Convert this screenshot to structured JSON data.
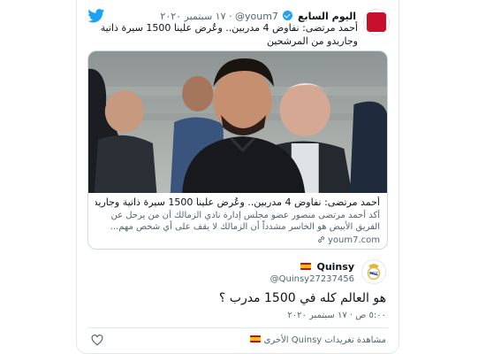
{
  "quoted_tweet": {
    "author_name": "اليوم السابع",
    "avatar_text": "اليوم\nالسابع",
    "handle": "@youm7",
    "date": "١٧ سبتمبر ٢٠٢٠",
    "separator": "·",
    "text": "أحمد مرتضى: نفاوض 4 مدربين.. وعُرض علينا 1500 سيرة ذاتية وجاريدو من المرشحين",
    "link_card": {
      "title": "أحمد مرتضى: نفاوض 4 مدربين.. وعُرض علينا 1500 سيرة ذاتية وجاريدو ...",
      "description": "أكد أحمد مرتضى منصور عضو مجلس إدارة نادي الزمالك أن من يرحل عن الفريق الأبيض هو الخاسر مشدداً أن الزمالك لا يقف على أي شخص مهم...",
      "domain": "youm7.com"
    }
  },
  "tweet": {
    "author_name": "Quinsy",
    "handle": "@Quinsy27237456",
    "text": "هو العالم كله في 1500 مدرب ؟",
    "timestamp": "٥:٠٠ ص · ١٧ سبتمبر ٢٠٢٠"
  },
  "actions": {
    "more_tweets_label": "مشاهدة تغريدات Quinsy الأخرى"
  },
  "colors": {
    "twitter_blue": "#1da1f2",
    "text_primary": "#0f1419",
    "text_secondary": "#536471",
    "border": "#e1e8ed"
  }
}
